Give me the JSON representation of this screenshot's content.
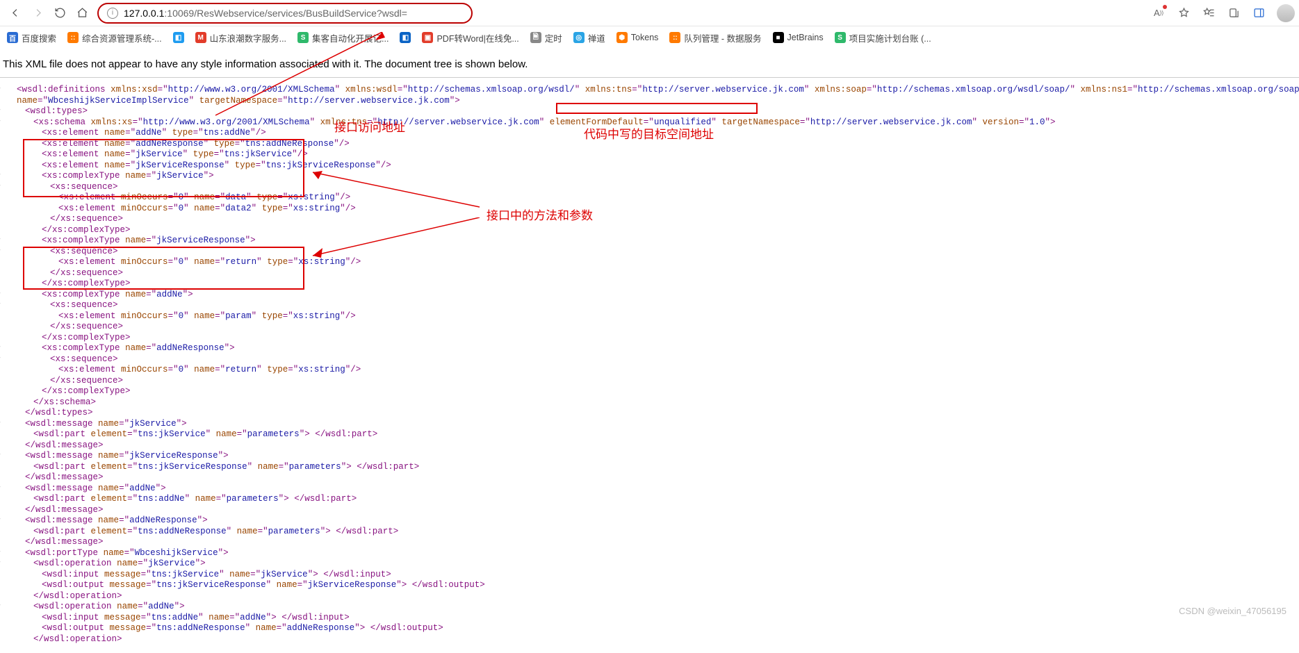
{
  "toolbar": {
    "url_host": "127.0.0.1",
    "url_path": ":10069/ResWebservice/services/BusBuildService?wsdl="
  },
  "bookmarks": [
    {
      "label": "百度搜索",
      "color": "#2a6cd3",
      "txt": "百"
    },
    {
      "label": "综合资源管理系统-...",
      "color": "#ff7a00",
      "txt": "::"
    },
    {
      "label": "",
      "color": "#1e9cf0",
      "txt": "◧"
    },
    {
      "label": "山东浪潮数字服务...",
      "color": "#e23c2a",
      "txt": "M"
    },
    {
      "label": "集客自动化开展记...",
      "color": "#2fb96b",
      "txt": "S"
    },
    {
      "label": "",
      "color": "#0a63c5",
      "txt": "◧"
    },
    {
      "label": "PDF转Word|在线免...",
      "color": "#e23c2a",
      "txt": "▣"
    },
    {
      "label": "定时",
      "color": "#888",
      "txt": "🗎"
    },
    {
      "label": "禅道",
      "color": "#2aa4e5",
      "txt": "◎"
    },
    {
      "label": "Tokens",
      "color": "#ff7a00",
      "txt": "⬢"
    },
    {
      "label": "队列管理 - 数据服务",
      "color": "#ff7a00",
      "txt": "::"
    },
    {
      "label": "JetBrains",
      "color": "#000",
      "txt": "■"
    },
    {
      "label": "项目实施计划台账 (...",
      "color": "#2fb96b",
      "txt": "S"
    }
  ],
  "msg": "This XML file does not appear to have any style information associated with it. The document tree is shown below.",
  "anno": {
    "a1": "接口访问地址",
    "a2": "代码中写的目标空间地址",
    "a3": "接口中的方法和参数"
  },
  "wm": "CSDN @weixin_47056195",
  "xml": {
    "def": {
      "t": "wsdl:definitions",
      "attrs": [
        [
          "xmlns:xsd",
          "http://www.w3.org/2001/XMLSchema"
        ],
        [
          "xmlns:wsdl",
          "http://schemas.xmlsoap.org/wsdl/"
        ],
        [
          "xmlns:tns",
          "http://server.webservice.jk.com"
        ],
        [
          "xmlns:soap",
          "http://schemas.xmlsoap.org/wsdl/soap/"
        ],
        [
          "xmlns:ns1",
          "http://schemas.xmlsoap.org/soap/http"
        ],
        [
          "name",
          "WbceshijkServiceImplService"
        ],
        [
          "targetNamespace",
          "http://server.webservice.jk.com"
        ]
      ]
    },
    "types": {
      "t": "wsdl:types"
    },
    "schema": {
      "t": "xs:schema",
      "attrs": [
        [
          "xmlns:xs",
          "http://www.w3.org/2001/XMLSchema"
        ],
        [
          "xmlns:tns",
          "http://server.webservice.jk.com"
        ],
        [
          "elementFormDefault",
          "unqualified"
        ],
        [
          "targetNamespace",
          "http://server.webservice.jk.com"
        ],
        [
          "version",
          "1.0"
        ]
      ]
    },
    "el_addNe": [
      [
        "name",
        "addNe"
      ],
      [
        "type",
        "tns:addNe"
      ]
    ],
    "el_addNeResp": [
      [
        "name",
        "addNeResponse"
      ],
      [
        "type",
        "tns:addNeResponse"
      ]
    ],
    "el_jkSvc": [
      [
        "name",
        "jkService"
      ],
      [
        "type",
        "tns:jkService"
      ]
    ],
    "el_jkSvcResp": [
      [
        "name",
        "jkServiceResponse"
      ],
      [
        "type",
        "tns:jkServiceResponse"
      ]
    ],
    "ct_jkService": {
      "name": "jkService",
      "els": [
        [
          [
            "minOccurs",
            "0"
          ],
          [
            "name",
            "data"
          ],
          [
            "type",
            "xs:string"
          ]
        ],
        [
          [
            "minOccurs",
            "0"
          ],
          [
            "name",
            "data2"
          ],
          [
            "type",
            "xs:string"
          ]
        ]
      ]
    },
    "ct_jkServiceResponse": {
      "name": "jkServiceResponse",
      "els": [
        [
          [
            "minOccurs",
            "0"
          ],
          [
            "name",
            "return"
          ],
          [
            "type",
            "xs:string"
          ]
        ]
      ]
    },
    "ct_addNe": {
      "name": "addNe",
      "els": [
        [
          [
            "minOccurs",
            "0"
          ],
          [
            "name",
            "param"
          ],
          [
            "type",
            "xs:string"
          ]
        ]
      ]
    },
    "ct_addNeResponse": {
      "name": "addNeResponse",
      "els": [
        [
          [
            "minOccurs",
            "0"
          ],
          [
            "name",
            "return"
          ],
          [
            "type",
            "xs:string"
          ]
        ]
      ]
    },
    "msgs": [
      {
        "name": "jkService",
        "part": [
          [
            "element",
            "tns:jkService"
          ],
          [
            "name",
            "parameters"
          ]
        ]
      },
      {
        "name": "jkServiceResponse",
        "part": [
          [
            "element",
            "tns:jkServiceResponse"
          ],
          [
            "name",
            "parameters"
          ]
        ]
      },
      {
        "name": "addNe",
        "part": [
          [
            "element",
            "tns:addNe"
          ],
          [
            "name",
            "parameters"
          ]
        ]
      },
      {
        "name": "addNeResponse",
        "part": [
          [
            "element",
            "tns:addNeResponse"
          ],
          [
            "name",
            "parameters"
          ]
        ]
      }
    ],
    "portType": {
      "name": "WbceshijkService",
      "ops": [
        {
          "name": "jkService",
          "in": [
            [
              "message",
              "tns:jkService"
            ],
            [
              "name",
              "jkService"
            ]
          ],
          "out": [
            [
              "message",
              "tns:jkServiceResponse"
            ],
            [
              "name",
              "jkServiceResponse"
            ]
          ]
        },
        {
          "name": "addNe",
          "in": [
            [
              "message",
              "tns:addNe"
            ],
            [
              "name",
              "addNe"
            ]
          ],
          "out": [
            [
              "message",
              "tns:addNeResponse"
            ],
            [
              "name",
              "addNeResponse"
            ]
          ]
        }
      ]
    }
  }
}
